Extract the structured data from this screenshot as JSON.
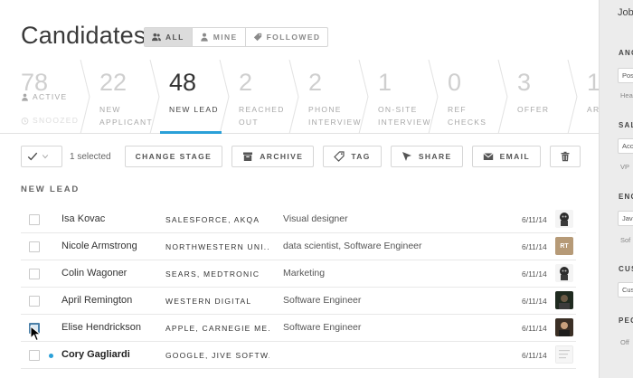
{
  "header": {
    "title": "Candidates",
    "filters": [
      {
        "label": "ALL",
        "icon": "people-icon",
        "active": true
      },
      {
        "label": "MINE",
        "icon": "person-icon",
        "active": false
      },
      {
        "label": "FOLLOWED",
        "icon": "tag-icon",
        "active": false
      }
    ]
  },
  "pipeline": {
    "first": {
      "count": "78",
      "active_label": "ACTIVE",
      "snoozed_label": "SNOOZED"
    },
    "stages": [
      {
        "count": "22",
        "label": "NEW APPLICANT",
        "label_lines": [
          "NEW",
          "APPLICANT"
        ]
      },
      {
        "count": "48",
        "label": "NEW LEAD",
        "label_lines": [
          "NEW LEAD"
        ],
        "active": true
      },
      {
        "count": "2",
        "label": "REACHED OUT",
        "label_lines": [
          "REACHED",
          "OUT"
        ]
      },
      {
        "count": "2",
        "label": "PHONE INTERVIEW",
        "label_lines": [
          "PHONE",
          "INTERVIEW"
        ]
      },
      {
        "count": "1",
        "label": "ON-SITE INTERVIEW",
        "label_lines": [
          "ON-SITE",
          "INTERVIEW"
        ]
      },
      {
        "count": "0",
        "label": "REF CHECKS",
        "label_lines": [
          "REF",
          "CHECKS"
        ]
      },
      {
        "count": "3",
        "label": "OFFER",
        "label_lines": [
          "OFFER"
        ]
      },
      {
        "count": "1",
        "label": "AR",
        "label_lines": [
          "AR"
        ]
      }
    ],
    "accent_color": "#2aa0d8"
  },
  "toolbar": {
    "selected_text": "1 selected",
    "change_stage": "CHANGE STAGE",
    "archive": "ARCHIVE",
    "tag": "TAG",
    "share": "SHARE",
    "email": "EMAIL"
  },
  "section": {
    "title": "NEW LEAD"
  },
  "candidates": [
    {
      "name": "Isa Kovac",
      "company": "SALESFORCE, AKQA",
      "title": "Visual designer",
      "date": "6/11/14",
      "checked": false,
      "unread": false,
      "avatar": "robot"
    },
    {
      "name": "Nicole Armstrong",
      "company": "NORTHWESTERN UNI...",
      "title": "data scientist, Software Engineer",
      "date": "6/11/14",
      "checked": false,
      "unread": false,
      "avatar": "initials",
      "initials": "RT"
    },
    {
      "name": "Colin Wagoner",
      "company": "SEARS, MEDTRONIC",
      "title": "Marketing",
      "date": "6/11/14",
      "checked": false,
      "unread": false,
      "avatar": "robot"
    },
    {
      "name": "April Remington",
      "company": "WESTERN DIGITAL",
      "title": "Software Engineer",
      "date": "6/11/14",
      "checked": false,
      "unread": false,
      "avatar": "photo"
    },
    {
      "name": "Elise Hendrickson",
      "company": "APPLE, CARNEGIE ME...",
      "title": "Software Engineer",
      "date": "6/11/14",
      "checked": true,
      "unread": false,
      "avatar": "photo"
    },
    {
      "name": "Cory Gagliardi",
      "company": "GOOGLE, JIVE SOFTW...",
      "title": "",
      "date": "6/11/14",
      "checked": false,
      "unread": true,
      "avatar": "doc"
    }
  ],
  "side_panel": {
    "heading": "Job",
    "sections": [
      {
        "label": "ANG",
        "fields": [
          "Posi"
        ],
        "plain": [
          "Hea"
        ]
      },
      {
        "label": "SAL",
        "fields": [
          "Acc"
        ],
        "plain": [
          "VP"
        ]
      },
      {
        "label": "ENG",
        "fields": [
          "Java"
        ],
        "plain": [
          "Sof"
        ]
      },
      {
        "label": "CUS",
        "fields": [
          "Cus"
        ],
        "plain": []
      },
      {
        "label": "PEO",
        "fields": [],
        "plain": [
          "Off"
        ]
      }
    ]
  }
}
